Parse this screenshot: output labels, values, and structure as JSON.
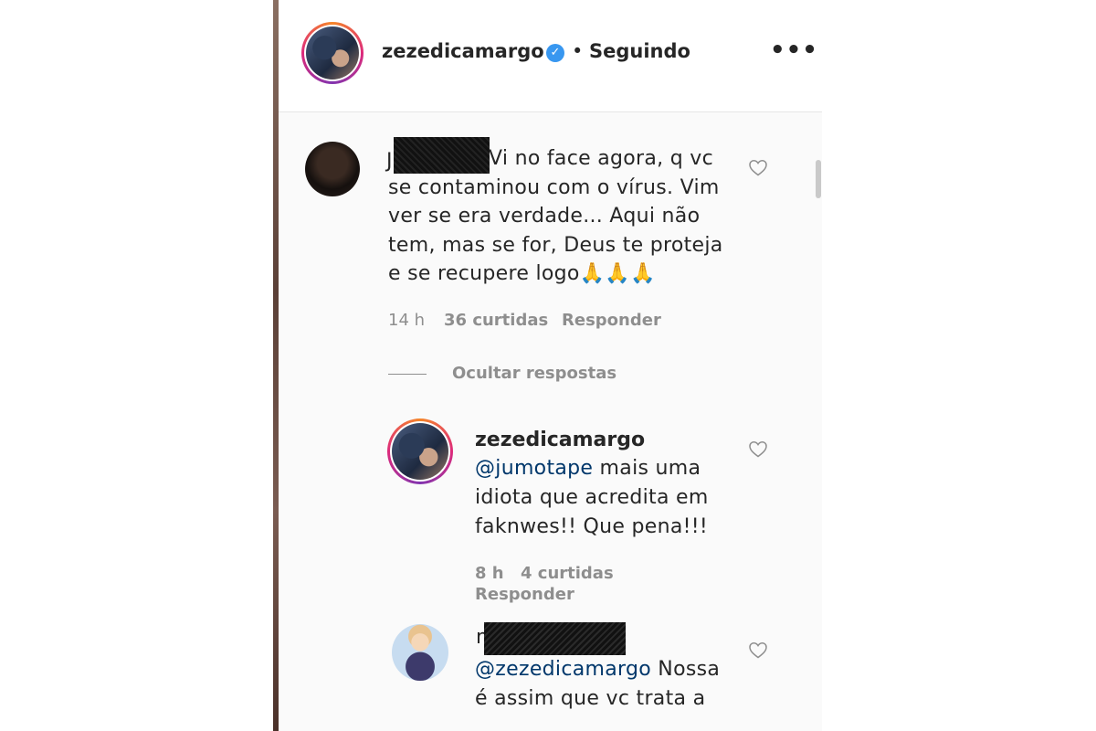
{
  "header": {
    "username": "zezedicamargo",
    "separator": "•",
    "follow_status": "Seguindo",
    "more_label": "•••",
    "verified_mark": "✓"
  },
  "comment": {
    "user_initial": "J",
    "text": "Vi no face agora, q vc se contaminou com o vírus. Vim ver se era verdade... Aqui não tem, mas se for, Deus te proteja e se recupere logo🙏🙏🙏",
    "time": "14 h",
    "likes": "36 curtidas",
    "reply_label": "Responder",
    "hide_replies": "Ocultar respostas"
  },
  "replies": [
    {
      "username": "zezedicamargo",
      "mention": "@jumotape",
      "text": " mais uma idiota que acredita em faknwes!! Que pena!!!",
      "time": "8 h",
      "likes": "4 curtidas",
      "reply_label": "Responder"
    },
    {
      "user_initial": "n",
      "mention": "@zezedicamargo",
      "text": " Nossa é assim que vc trata a"
    }
  ],
  "icons": {
    "heart": "heart-outline-icon",
    "more": "more-horizontal-icon",
    "verified": "verified-badge-icon"
  },
  "colors": {
    "verified": "#3897f0",
    "mention": "#00376b",
    "muted": "#8e8e8e",
    "text": "#262626"
  }
}
